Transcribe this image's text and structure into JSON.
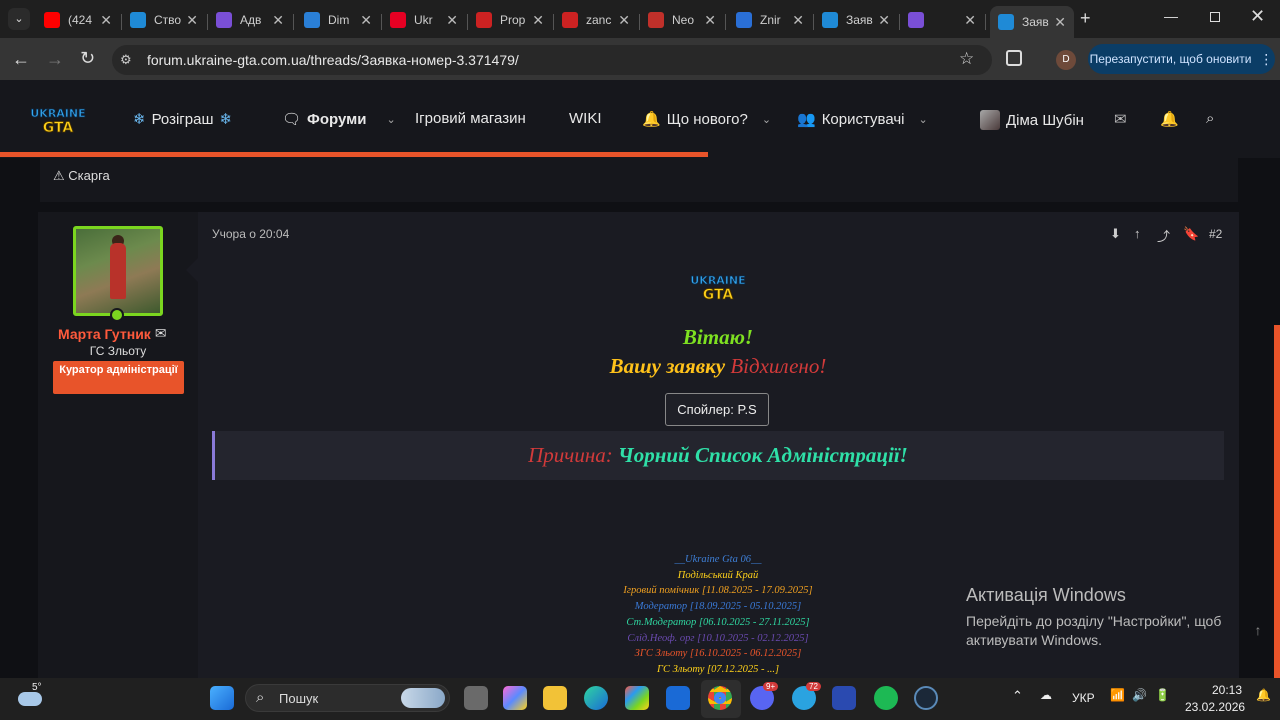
{
  "browser": {
    "tabs": [
      {
        "label": "(424",
        "icon": "youtube-icon",
        "color": "#ff0000"
      },
      {
        "label": "Ство",
        "icon": "ukraine-gta-icon",
        "color": "#1f8ad6"
      },
      {
        "label": "Адв",
        "icon": "form-icon",
        "color": "#7a4fd6"
      },
      {
        "label": "Dim",
        "icon": "t-icon",
        "color": "#2a7fd6"
      },
      {
        "label": "Ukr",
        "icon": "pinterest-icon",
        "color": "#e60023"
      },
      {
        "label": "Prop",
        "icon": "car-icon",
        "color": "#c22"
      },
      {
        "label": "zanc",
        "icon": "car-icon",
        "color": "#c22"
      },
      {
        "label": "Neo",
        "icon": "neo-icon",
        "color": "#c0302a"
      },
      {
        "label": "Znir",
        "icon": "p-icon",
        "color": "#2a6fd6"
      },
      {
        "label": "Заяв",
        "icon": "ukraine-gta-icon",
        "color": "#1f8ad6"
      },
      {
        "label": "",
        "icon": "form-icon",
        "color": "#7a4fd6"
      },
      {
        "label": "Заяв",
        "icon": "ukraine-gta-icon",
        "color": "#1f8ad6"
      }
    ],
    "url": "forum.ukraine-gta.com.ua/threads/Заявка-номер-3.371479/",
    "profile_initial": "D",
    "relaunch_label": "Перезапустити, щоб оновити"
  },
  "site": {
    "nav": {
      "giveaway": "Розіграш",
      "forums": "Форуми",
      "shop": "Ігровий магазин",
      "wiki": "WIKI",
      "whats_new": "Що нового?",
      "users": "Користувачі",
      "account": "Діма Шубін"
    },
    "prev_action": "Скарга"
  },
  "post": {
    "author": "Марта Гутник",
    "author_title": "ГС Зльоту",
    "author_badge": "Куратор адміністрації",
    "date": "Учора о 20:04",
    "number": "#2",
    "greeting": "Вітаю!",
    "result_prefix": "Вашу заявку ",
    "result_status": "Відхилено!",
    "spoiler_label": "Спойлер: P.S",
    "reason_label": "Причина: ",
    "reason_value": "Чорний Список Адміністрації!",
    "signature": [
      {
        "text": "__Ukraine Gta 06__",
        "color": "#3e7fd6"
      },
      {
        "text": "Подільський Край",
        "color": "#ffd21a"
      },
      {
        "text": "Ігровий помічник [11.08.2025 - 17.09.2025]",
        "color": "#f0a020"
      },
      {
        "text": "Модератор [18.09.2025 - 05.10.2025]",
        "color": "#3a7ad8"
      },
      {
        "text": "Ст.Модератор [06.10.2025 - 27.11.2025]",
        "color": "#2fd6a0"
      },
      {
        "text": "Слід.Неоф. орг [10.10.2025 - 02.12.2025]",
        "color": "#6a4ab0"
      },
      {
        "text": "ЗГС Зльоту [16.10.2025 - 06.12.2025]",
        "color": "#e8542a"
      },
      {
        "text": "ГС Зльоту [07.12.2025 - ...]",
        "color": "#ffd21a"
      }
    ]
  },
  "os": {
    "activation_title": "Активація Windows",
    "activation_text": "Перейдіть до розділу \"Настройки\", щоб активувати Windows.",
    "weather": "5°",
    "search_placeholder": "Пошук",
    "language": "УКР",
    "time": "20:13",
    "date": "23.02.2026",
    "discord_badge": "9+",
    "telegram_badge": "72"
  }
}
